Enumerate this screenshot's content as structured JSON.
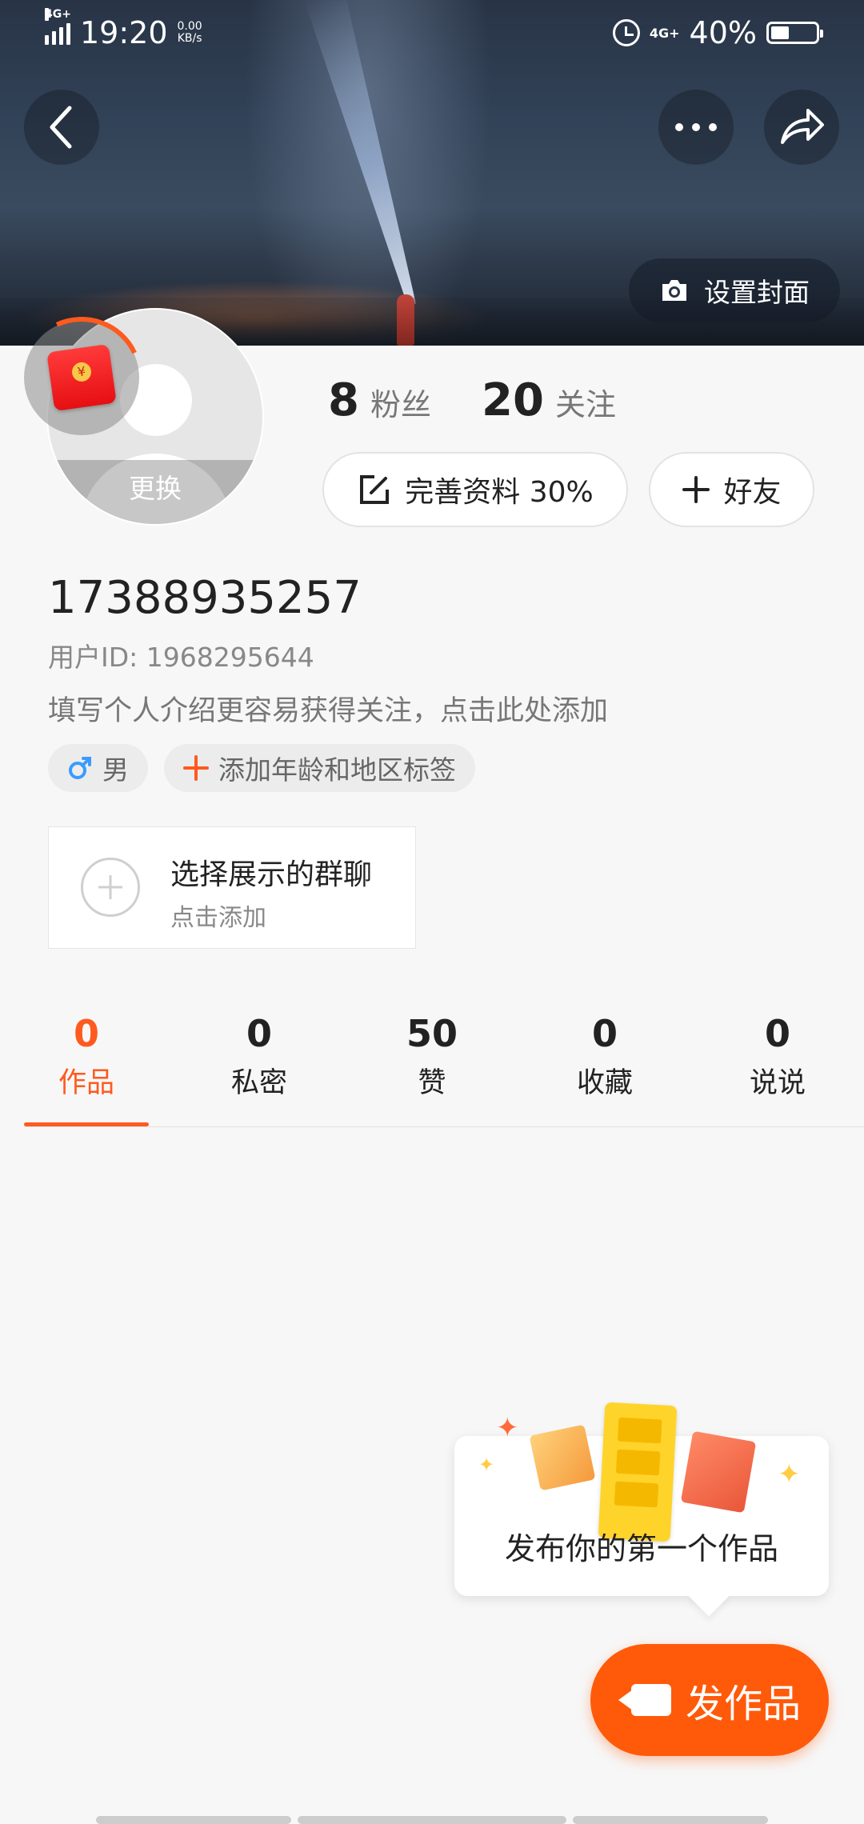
{
  "status_bar": {
    "time": "19:20",
    "network_left": "4G+",
    "speed_value": "0.00",
    "speed_unit": "KB/s",
    "network_right": "4G+",
    "battery": "40%",
    "battery_level": 0.4
  },
  "header": {
    "cover_button_label": "设置封面"
  },
  "avatar": {
    "change_label": "更换"
  },
  "stats": {
    "fans_count": "8",
    "fans_label": "粉丝",
    "following_count": "20",
    "following_label": "关注"
  },
  "actions": {
    "complete_profile_label": "完善资料 30%",
    "add_friend_label": "好友"
  },
  "profile": {
    "name": "17388935257",
    "user_id": "用户ID: 1968295644",
    "intro_placeholder": "填写个人介绍更容易获得关注，点击此处添加",
    "gender_label": "男",
    "add_tags_label": "添加年龄和地区标签"
  },
  "group_chat": {
    "title": "选择展示的群聊",
    "subtitle": "点击添加"
  },
  "tabs": [
    {
      "count": "0",
      "label": "作品",
      "active": true
    },
    {
      "count": "0",
      "label": "私密",
      "active": false
    },
    {
      "count": "50",
      "label": "赞",
      "active": false
    },
    {
      "count": "0",
      "label": "收藏",
      "active": false
    },
    {
      "count": "0",
      "label": "说说",
      "active": false
    }
  ],
  "prompt": {
    "text": "发布你的第一个作品"
  },
  "fab": {
    "label": "发作品"
  },
  "colors": {
    "accent": "#ff5a1f",
    "male_blue": "#3a9bff"
  }
}
